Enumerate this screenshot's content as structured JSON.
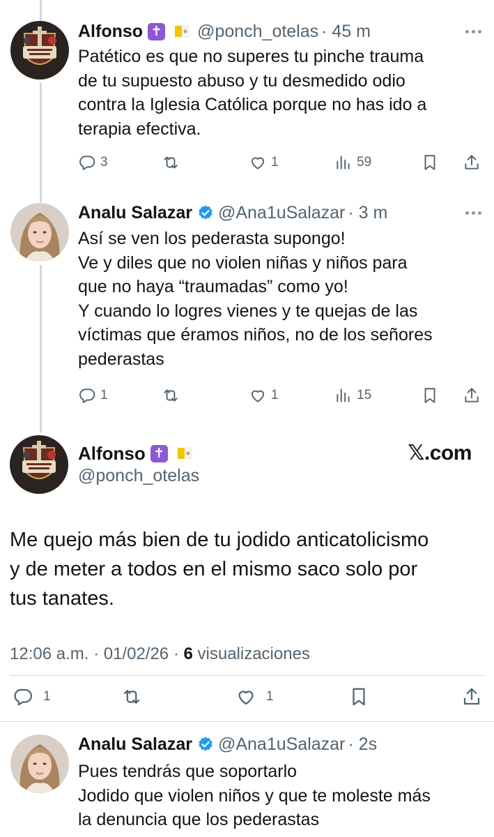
{
  "tweets": [
    {
      "name": "Alfonso",
      "handle": "@ponch_otelas",
      "time": "· 45 m",
      "body": "Patético es que no superes tu pinche trauma\nde tu supuesto abuso y tu desmedido odio\ncontra la Iglesia Católica porque no has ido a\nterapia efectiva.",
      "replies": "3",
      "likes": "1",
      "views": "59"
    },
    {
      "name": "Analu Salazar",
      "handle": "@Ana1uSalazar",
      "time": "· 3 m",
      "body": "Así se ven los pederasta supongo!\nVe y diles que no violen niñas  y niños para\nque no haya “traumadas” como yo!\nY cuando lo logres vienes y te quejas de las\nvíctimas que éramos niños, no de los señores\npederastas",
      "replies": "1",
      "likes": "1",
      "views": "15"
    }
  ],
  "main_tweet": {
    "name": "Alfonso",
    "handle": "@ponch_otelas",
    "brand": "𝕏.com",
    "body": "Me quejo más bien de tu jodido anticatolicismo\ny de meter a todos en el mismo saco solo por\ntus tanates.",
    "timestamp": "12:06 a.m. · 01/02/26 · ",
    "views_count": "6",
    "views_label": " visualizaciones",
    "replies": "1",
    "likes": "1"
  },
  "reply": {
    "name": "Analu Salazar",
    "handle": "@Ana1uSalazar",
    "time": "· 2s",
    "body": "Pues tendrás que soportarlo\nJodido que violen niños y que te moleste más\nla denuncia que los pederastas"
  },
  "icons": {
    "reply": "reply-icon",
    "retweet": "retweet-icon",
    "like": "heart-icon",
    "views": "views-icon",
    "bookmark": "bookmark-icon",
    "share": "share-icon"
  },
  "colors": {
    "text": "#0f1419",
    "secondary": "#536471",
    "verified": "#1d9bf0",
    "cross_emoji": "#8e57d6",
    "thread_line": "#cfd9de"
  }
}
